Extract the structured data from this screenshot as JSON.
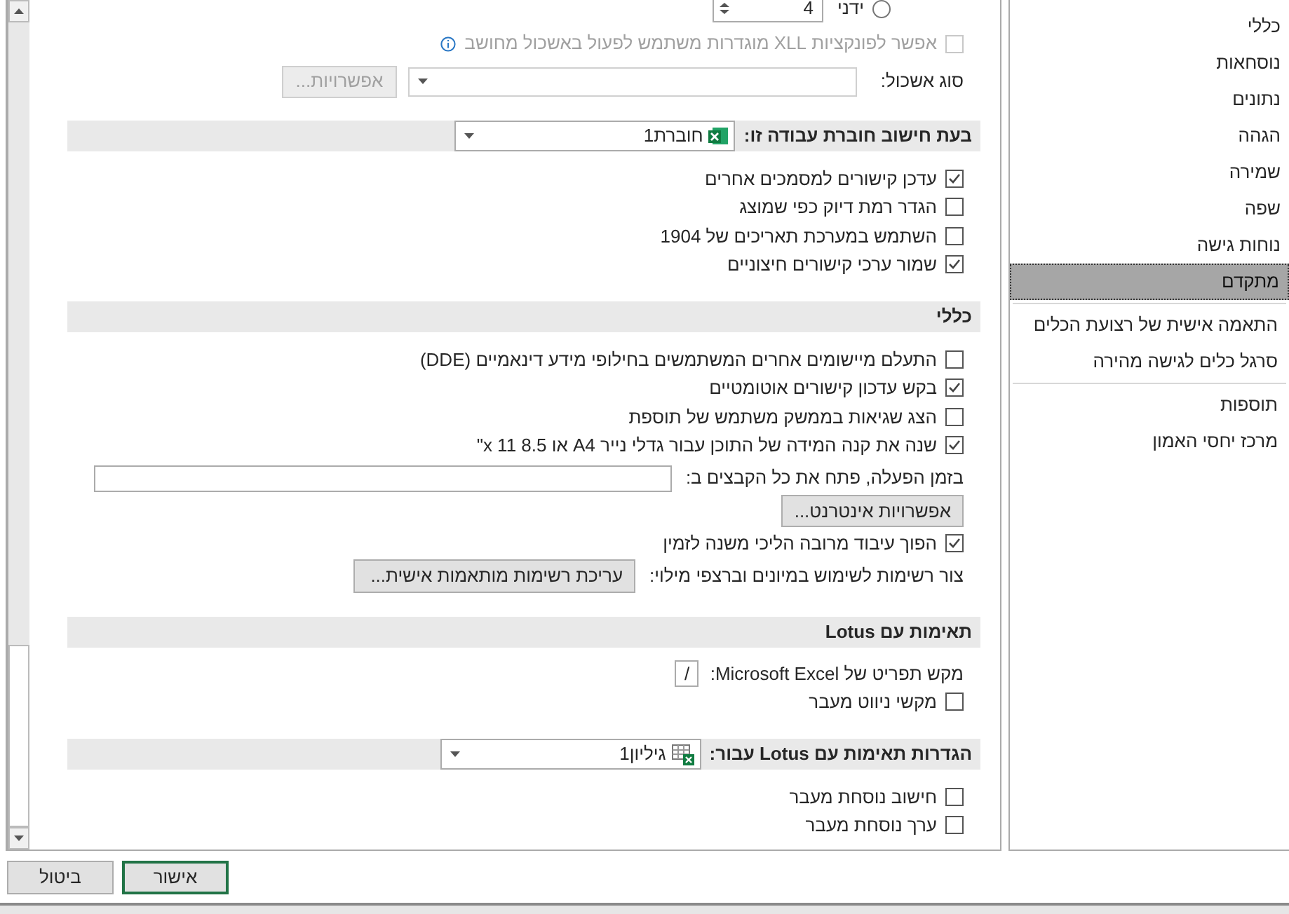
{
  "top_options": {
    "manual_radio": {
      "label": "ידני",
      "selected": false
    },
    "threads_value": "4",
    "xll_checkbox": {
      "label": "אפשר לפונקציות XLL מוגדרות משתמש לפעול באשכול מחושב",
      "checked": false,
      "disabled": true
    },
    "cluster_type": {
      "label": "סוג אשכול:",
      "button": "אפשרויות...",
      "button_disabled": true
    }
  },
  "sections": [
    {
      "title": "בעת חישוב חוברת עבודה זו:",
      "dropdown": {
        "value": "חוברת1",
        "kind": "workbook"
      },
      "items": [
        {
          "kind": "checkbox",
          "label": "עדכן קישורים למסמכים אחרים",
          "checked": true
        },
        {
          "kind": "checkbox",
          "label": "הגדר רמת דיוק כפי שמוצג",
          "checked": false
        },
        {
          "kind": "checkbox",
          "label": "השתמש במערכת תאריכים של 1904",
          "checked": false
        },
        {
          "kind": "checkbox",
          "label": "שמור ערכי קישורים חיצוניים",
          "checked": true
        }
      ]
    },
    {
      "title": "כללי",
      "items": [
        {
          "kind": "checkbox",
          "label": "התעלם מיישומים אחרים המשתמשים בחילופי מידע דינאמיים (DDE)",
          "checked": false
        },
        {
          "kind": "checkbox",
          "label": "בקש עדכון קישורים אוטומטיים",
          "checked": true
        },
        {
          "kind": "checkbox",
          "label": "הצג שגיאות בממשק משתמש של תוספת",
          "checked": false
        },
        {
          "kind": "checkbox",
          "label": "שנה את קנה המידה של התוכן עבור גדלי נייר A4 או 8.5 x 11\"",
          "checked": true
        },
        {
          "kind": "field",
          "label": "בזמן הפעלה, פתח את כל הקבצים ב:"
        },
        {
          "kind": "button",
          "button": "אפשרויות אינטרנט..."
        },
        {
          "kind": "checkbox",
          "label": "הפוך עיבוד מרובה הליכי משנה לזמין",
          "checked": true
        },
        {
          "kind": "button_row",
          "label": "צור רשימות לשימוש במיונים וברצפי מילוי:",
          "button": "עריכת רשימות מותאמות אישית..."
        }
      ]
    },
    {
      "title": "תאימות עם Lotus",
      "items": [
        {
          "kind": "key_field",
          "label": "מקש תפריט של Microsoft Excel:",
          "value": "/"
        },
        {
          "kind": "checkbox",
          "label": "מקשי ניווט מעבר",
          "checked": false
        }
      ]
    },
    {
      "title": "הגדרות תאימות עם Lotus עבור:",
      "dropdown": {
        "value": "גיליון1",
        "kind": "sheet"
      },
      "items": [
        {
          "kind": "checkbox",
          "label": "חישוב נוסחת מעבר",
          "checked": false
        },
        {
          "kind": "checkbox",
          "label": "ערך נוסחת מעבר",
          "checked": false
        }
      ]
    }
  ],
  "nav": {
    "groups": [
      [
        {
          "label": "כללי",
          "selected": false
        },
        {
          "label": "נוסחאות",
          "selected": false
        },
        {
          "label": "נתונים",
          "selected": false
        },
        {
          "label": "הגהה",
          "selected": false
        },
        {
          "label": "שמירה",
          "selected": false
        },
        {
          "label": "שפה",
          "selected": false
        },
        {
          "label": "נוחות גישה",
          "selected": false
        },
        {
          "label": "מתקדם",
          "selected": true
        }
      ],
      [
        {
          "label": "התאמה אישית של רצועת הכלים",
          "selected": false
        },
        {
          "label": "סרגל כלים לגישה מהירה",
          "selected": false
        }
      ],
      [
        {
          "label": "תוספות",
          "selected": false
        },
        {
          "label": "מרכז יחסי האמון",
          "selected": false
        }
      ]
    ]
  },
  "footer": [
    {
      "label": "אישור",
      "default": true
    },
    {
      "label": "ביטול",
      "default": false
    }
  ]
}
